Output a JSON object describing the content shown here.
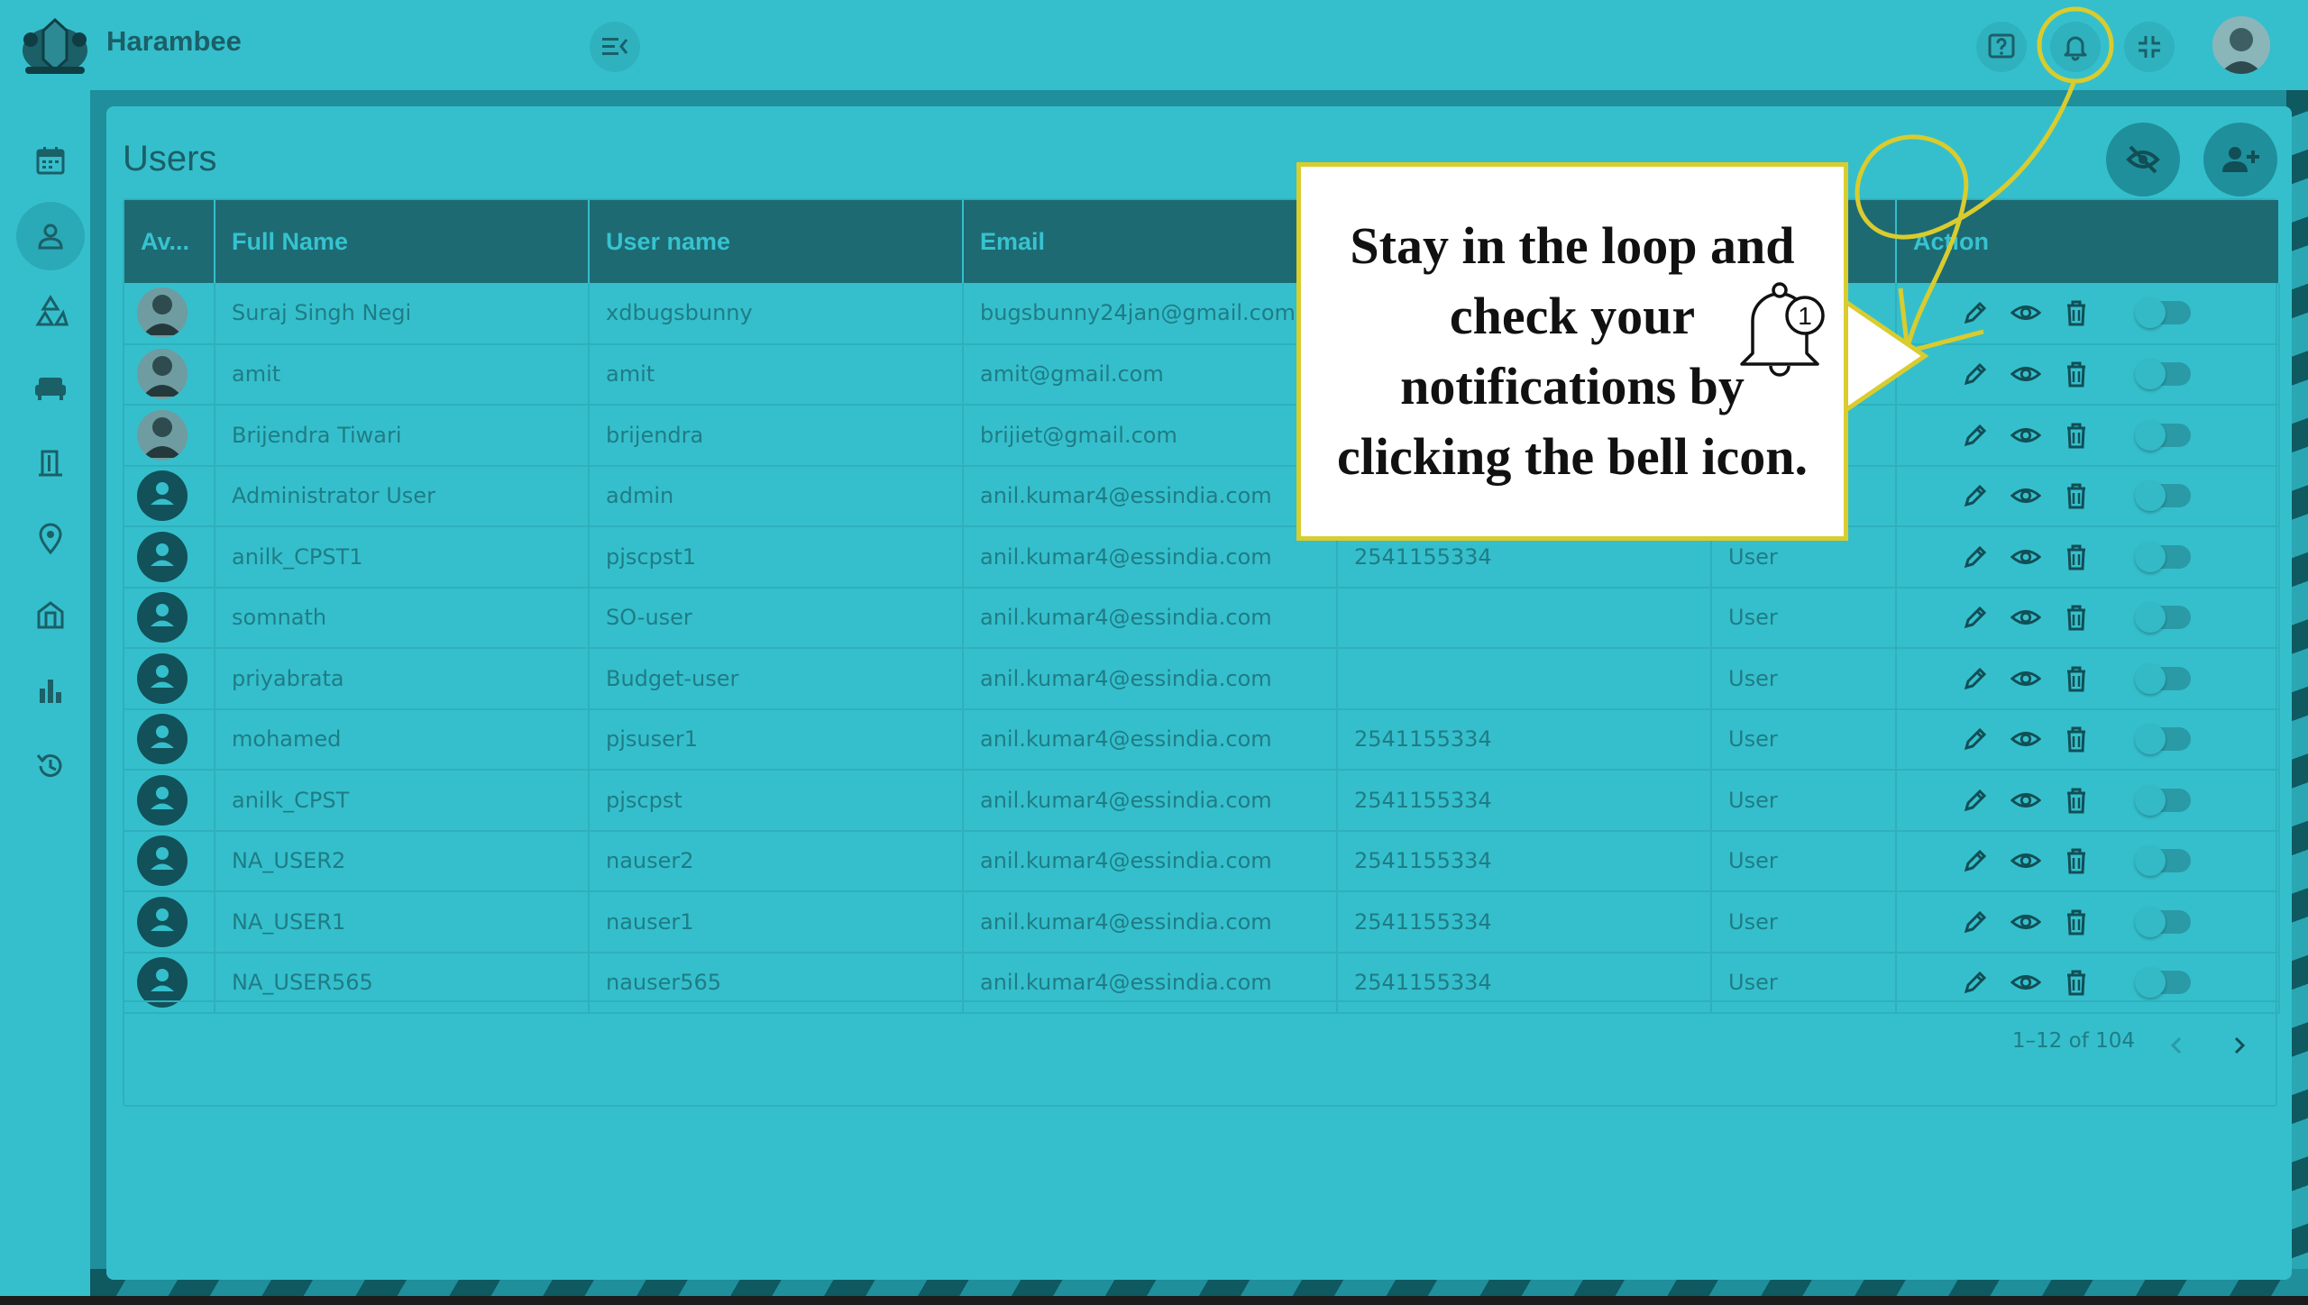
{
  "app": {
    "brand": "Harambee"
  },
  "page": {
    "title": "Users"
  },
  "topbar": {
    "icons": [
      "menu-collapse-icon",
      "help-icon",
      "bell-icon",
      "fullscreen-exit-icon",
      "user-avatar"
    ]
  },
  "sidebar": {
    "items": [
      {
        "icon": "calendar-icon"
      },
      {
        "icon": "user-icon",
        "active": true
      },
      {
        "icon": "recycle-icon"
      },
      {
        "icon": "sofa-icon"
      },
      {
        "icon": "door-icon"
      },
      {
        "icon": "location-pin-icon"
      },
      {
        "icon": "building-icon"
      },
      {
        "icon": "bar-chart-icon"
      },
      {
        "icon": "history-icon"
      }
    ]
  },
  "table": {
    "columns": [
      "Av...",
      "Full Name",
      "User name",
      "Email",
      "",
      "",
      "Action"
    ],
    "rows": [
      {
        "full_name": "Suraj Singh Negi",
        "username": "xdbugsbunny",
        "email": "bugsbunny24jan@gmail.com",
        "phone": "",
        "role": "",
        "photo": true
      },
      {
        "full_name": "amit",
        "username": "amit",
        "email": "amit@gmail.com",
        "phone": "",
        "role": "",
        "photo": true
      },
      {
        "full_name": "Brijendra Tiwari",
        "username": "brijendra",
        "email": "brijiet@gmail.com",
        "phone": "",
        "role": "",
        "photo": true
      },
      {
        "full_name": "Administrator User",
        "username": "admin",
        "email": "anil.kumar4@essindia.com",
        "phone": "",
        "role": "",
        "photo": false
      },
      {
        "full_name": "anilk_CPST1",
        "username": "pjscpst1",
        "email": "anil.kumar4@essindia.com",
        "phone": "2541155334",
        "role": "User",
        "photo": false
      },
      {
        "full_name": "somnath",
        "username": "SO-user",
        "email": "anil.kumar4@essindia.com",
        "phone": "",
        "role": "User",
        "photo": false
      },
      {
        "full_name": "priyabrata",
        "username": "Budget-user",
        "email": "anil.kumar4@essindia.com",
        "phone": "",
        "role": "User",
        "photo": false
      },
      {
        "full_name": "mohamed",
        "username": "pjsuser1",
        "email": "anil.kumar4@essindia.com",
        "phone": "2541155334",
        "role": "User",
        "photo": false
      },
      {
        "full_name": "anilk_CPST",
        "username": "pjscpst",
        "email": "anil.kumar4@essindia.com",
        "phone": "2541155334",
        "role": "User",
        "photo": false
      },
      {
        "full_name": "NA_USER2",
        "username": "nauser2",
        "email": "anil.kumar4@essindia.com",
        "phone": "2541155334",
        "role": "User",
        "photo": false
      },
      {
        "full_name": "NA_USER1",
        "username": "nauser1",
        "email": "anil.kumar4@essindia.com",
        "phone": "2541155334",
        "role": "User",
        "photo": false
      },
      {
        "full_name": "NA_USER565",
        "username": "nauser565",
        "email": "anil.kumar4@essindia.com",
        "phone": "2541155334",
        "role": "User",
        "photo": false
      }
    ]
  },
  "pagination": {
    "range": "1–12 of 104"
  },
  "callout": {
    "text": "Stay in the loop and check your notifications by clicking the bell icon.",
    "badge": "1",
    "border_color": "#d9cc2e"
  },
  "colors": {
    "primary": "#35bfcc",
    "header": "#1d6a73",
    "accent": "#d9cc2e"
  }
}
